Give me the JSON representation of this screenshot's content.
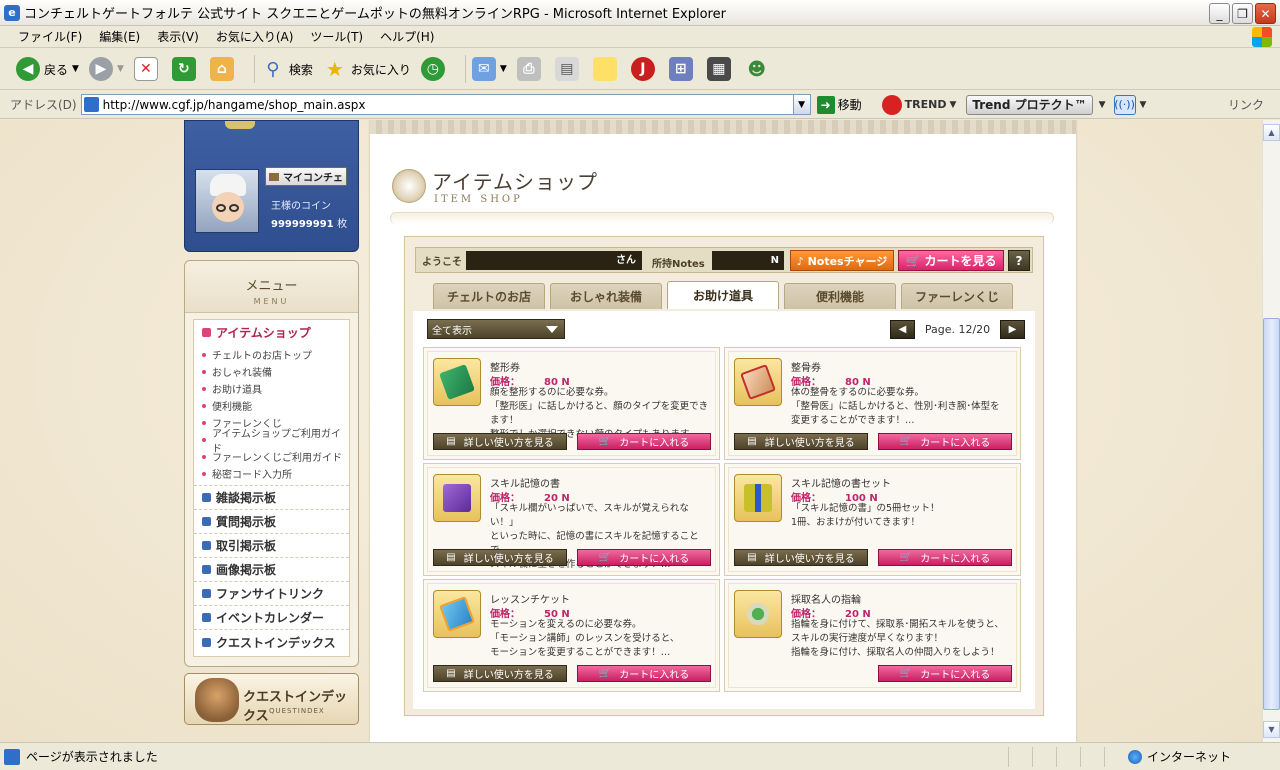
{
  "window": {
    "title": "コンチェルトゲートフォルテ 公式サイト スクエニとゲームポットの無料オンラインRPG - Microsoft Internet Explorer",
    "minimize": "_",
    "restore": "❐",
    "close": "✕"
  },
  "menubar": [
    "ファイル(F)",
    "編集(E)",
    "表示(V)",
    "お気に入り(A)",
    "ツール(T)",
    "ヘルプ(H)"
  ],
  "toolbar": {
    "back": "戻る",
    "search": "検索",
    "favorites": "お気に入り"
  },
  "address": {
    "label": "アドレス(D)",
    "url": "http://www.cgf.jp/hangame/shop_main.aspx",
    "go": "移動",
    "trend": "TREND",
    "trend_protect": "Trend プロテクト™",
    "links": "リンク"
  },
  "status": {
    "text": "ページが表示されました",
    "zone": "インターネット"
  },
  "user": {
    "mycon_button": "マイコンチェ",
    "coin_label": "王様のコイン",
    "coin_value": "999999991",
    "coin_unit": "枚"
  },
  "menu": {
    "title": "メニュー",
    "subtitle": "MENU",
    "first": "アイテムショップ",
    "sub_items": [
      "チェルトのお店トップ",
      "おしゃれ装備",
      "お助け道具",
      "便利機能",
      "ファーレンくじ",
      "アイテムショップご利用ガイド",
      "ファーレンくじご利用ガイド",
      "秘密コード入力所"
    ],
    "main_items": [
      "雑談掲示板",
      "質問掲示板",
      "取引掲示板",
      "画像掲示板",
      "ファンサイトリンク",
      "イベントカレンダー",
      "クエストインデックス"
    ],
    "quest_banner": "クエストインデックス",
    "quest_banner_sub": "QUESTINDEX"
  },
  "shop": {
    "title": "アイテムショップ",
    "subtitle": "ITEM SHOP",
    "welcome_label": "ようこそ",
    "welcome_suffix": "さん",
    "notes_label": "所持Notes",
    "notes_value": "N",
    "charge_button": "♪ Notesチャージ",
    "cart_button": "🛒 カートを見る",
    "help_button": "?",
    "tabs": [
      "チェルトのお店",
      "おしゃれ装備",
      "お助け道具",
      "便利機能",
      "ファーレンくじ"
    ],
    "active_tab": 2,
    "filter": "全て表示",
    "page": "Page. 12/20",
    "prev": "◀",
    "next": "▶",
    "price_label": "価格：",
    "detail_button": "詳しい使い方を見る",
    "add_cart_button": "カートに入れる",
    "items": [
      {
        "name": "整形券",
        "price": "80 N",
        "desc": "顔を整形するのに必要な券。\n「整形医」に話しかけると、顔のタイプを変更できます！\n整形でしか選択できない顔のタイプもあります。…"
      },
      {
        "name": "整骨券",
        "price": "80 N",
        "desc": "体の整骨をするのに必要な券。\n「整骨医」に話しかけると、性別･利き腕･体型を\n変更することができます！…"
      },
      {
        "name": "スキル記憶の書",
        "price": "20 N",
        "desc": "「スキル欄がいっぱいで、スキルが覚えられない！」\nといった時に、記憶の書にスキルを記憶することで、\nスキル欄に空きを作ることができます！…"
      },
      {
        "name": "スキル記憶の書セット",
        "price": "100 N",
        "desc": "「スキル記憶の書」の5冊セット！\n1冊、おまけが付いてきます！"
      },
      {
        "name": "レッスンチケット",
        "price": "50 N",
        "desc": "モーションを変えるのに必要な券。\n「モーション講師」のレッスンを受けると、\nモーションを変更することができます！…"
      },
      {
        "name": "採取名人の指輪",
        "price": "20 N",
        "desc": "指輪を身に付けて、採取系･開拓スキルを使うと、\nスキルの実行速度が早くなります！\n指輪を身に付け、採取名人の仲間入りをしよう！"
      }
    ]
  },
  "colors": {
    "accent": "#c0246a",
    "user_panel": "#3e5fa2",
    "charge": "#e06a10"
  }
}
